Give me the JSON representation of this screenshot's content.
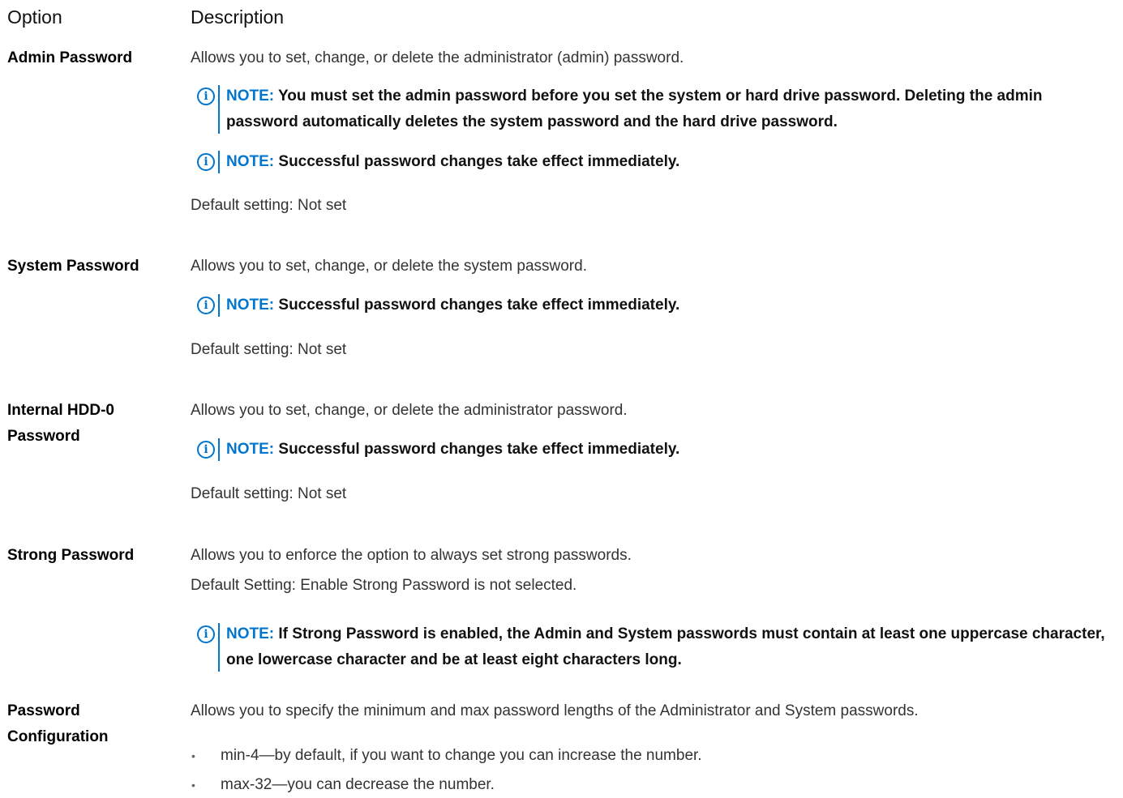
{
  "header": {
    "option": "Option",
    "description": "Description"
  },
  "note_label": "NOTE:",
  "options": [
    {
      "name": "Admin Password",
      "description": "Allows you to set, change, or delete the administrator (admin) password.",
      "notes": [
        "You must set the admin password before you set the system or hard drive password. Deleting the admin password automatically deletes the system password and the hard drive password.",
        "Successful password changes take effect immediately."
      ],
      "default": "Default setting: Not set"
    },
    {
      "name": "System Password",
      "description": "Allows you to set, change, or delete the system password.",
      "notes": [
        "Successful password changes take effect immediately."
      ],
      "default": "Default setting: Not set"
    },
    {
      "name_lines": [
        "Internal HDD-0",
        "Password"
      ],
      "description": "Allows you to set, change, or delete the administrator password.",
      "notes": [
        "Successful password changes take effect immediately."
      ],
      "default": "Default setting: Not set"
    },
    {
      "name": "Strong Password",
      "description": "Allows you to enforce the option to always set strong passwords.",
      "default": "Default Setting: Enable Strong Password is not selected.",
      "notes": [
        "If Strong Password is enabled, the Admin and System passwords must contain at least one uppercase character, one lowercase character and be at least eight characters long."
      ]
    },
    {
      "name_lines": [
        "Password",
        "Configuration"
      ],
      "description": "Allows you to specify the minimum and max password lengths of the Administrator and System passwords.",
      "bullets": [
        "min-4—by default, if you want to change you can increase the number.",
        "max-32—you can decrease the number."
      ]
    }
  ],
  "colors": {
    "accent": "#0076ce",
    "text": "#333333",
    "heading": "#000000"
  },
  "icons": {
    "note": "info-circle-icon"
  }
}
